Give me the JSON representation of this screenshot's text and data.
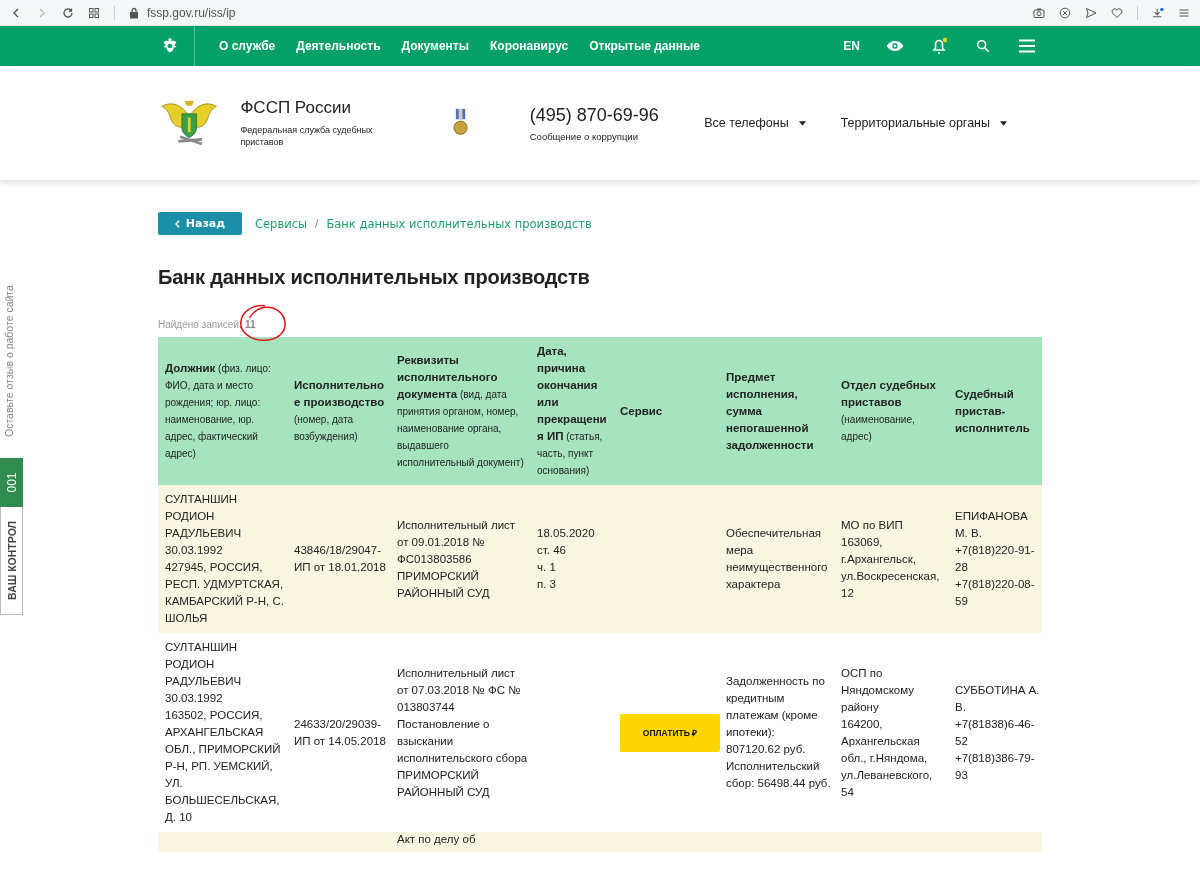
{
  "browser": {
    "url": "fssp.gov.ru/iss/ip"
  },
  "nav": {
    "items": [
      {
        "label": "О службе"
      },
      {
        "label": "Деятельность"
      },
      {
        "label": "Документы"
      },
      {
        "label": "Коронавирус"
      },
      {
        "label": "Открытые данные"
      }
    ],
    "language": "EN",
    "notification_dot": true
  },
  "header": {
    "org_name": "ФССП России",
    "org_subtitle": "Федеральная служба судебных приставов",
    "phone": "(495) 870-69-96",
    "phone_note": "Сообщение о коррупции",
    "dropdowns": [
      "Все телефоны",
      "Территориальные органы"
    ]
  },
  "back_button": "Назад",
  "breadcrumbs": [
    "Сервисы",
    "Банк данных исполнительных производств"
  ],
  "breadcrumb_separator": "/",
  "title": "Банк данных исполнительных производств",
  "records_found": "Найдено записей**: 11**",
  "side": {
    "feedback": "Оставьте отзыв о работе сайта",
    "control_label": "ВАШ КОНТРОЛ",
    "control_count": "001"
  },
  "table": {
    "columns": [
      "**Должник** (физ. лицо: ФИО, дата и место рождения; юр. лицо: наименование, юр. адрес, фактический адрес)",
      "**Исполнительное производство** (номер, дата возбуждения)",
      "**Реквизиты исполнительного документа** (вид, дата принятия органом, номер, наименование органа, выдавшего исполнительный документ)",
      "**Дата, причина окончания или прекращения ИП** (статья, часть, пункт основания)",
      "**Сервис**",
      "**Предмет исполнения, сумма непогашенной задолженности**",
      "**Отдел судебных приставов** (наименование, адрес)",
      "**Судебный пристав-исполнитель**"
    ],
    "rows": [
      [
        "СУЛТАНШИН РОДИОН РАДУЛЬЕВИЧ\n30.03.1992\n427945, РОССИЯ, РЕСП. УДМУРТСКАЯ, КАМБАРСКИЙ Р-Н, С. ШОЛЬЯ",
        "43846/18/29047-ИП от 18.01.2018",
        "Исполнительный лист от 09.01.2018 № ФС013803586\nПРИМОРСКИЙ РАЙОННЫЙ СУД",
        "18.05.2020\nст. 46\nч. 1\nп. 3",
        null,
        "Обеспечительная мера неимущественного характера",
        "МО по ВИП\n163069, г.Архангельск, ул.Воскресенская, 12",
        "ЕПИФАНОВА М. В.\n+7(818)220-91-28\n+7(818)220-08-59"
      ],
      [
        "СУЛТАНШИН РОДИОН РАДУЛЬЕВИЧ\n30.03.1992\n163502, РОССИЯ, АРХАНГЕЛЬСКАЯ ОБЛ., ПРИМОРСКИЙ Р-Н, РП. УЕМСКИЙ, УЛ. БОЛЬШЕСЕЛЬСКАЯ, Д. 10",
        "24633/20/29039-ИП от 14.05.2018",
        "Исполнительный лист от 07.03.2018 № ФС № 013803744\nПостановление о взыскании исполнительского сбора\nПРИМОРСКИЙ РАЙОННЫЙ СУД",
        null,
        {
          "kind": "pay_button",
          "label": "ОПЛАТИТЬ ₽"
        },
        "Задолженность по кредитным платежам (кроме ипотеки): 807120.62 руб. Исполнительский сбор: 56498.44 руб.",
        "ОСП по Няндомскому району\n164200, Архангельская обл., г.Няндома, ул.Леваневского, 54",
        "СУББОТИНА А. В.\n+7(81838)6-46-52\n+7(818)386-79-93"
      ],
      [
        null,
        null,
        "Акт по делу об"
      ]
    ]
  }
}
